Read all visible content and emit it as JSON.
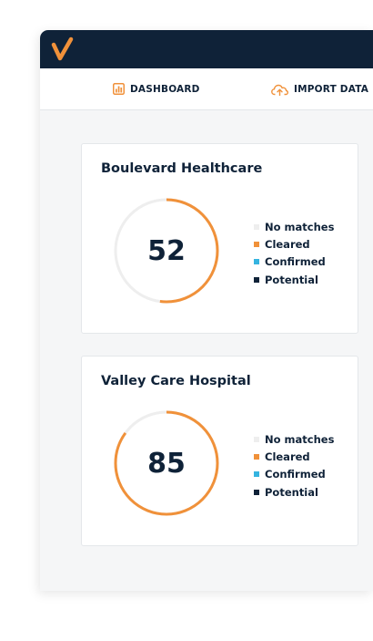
{
  "nav": {
    "dashboard_label": "DASHBOARD",
    "import_label": "IMPORT DATA"
  },
  "colors": {
    "navy": "#0f2238",
    "orange": "#f0913a",
    "cyan": "#35b4e0",
    "track": "#eeeeee"
  },
  "cards": [
    {
      "title": "Boulevard Healthcare",
      "value": "52",
      "cleared_fraction": 0.52,
      "legend": [
        "No matches",
        "Cleared",
        "Confirmed",
        "Potential"
      ]
    },
    {
      "title": "Valley Care Hospital",
      "value": "85",
      "cleared_fraction": 0.85,
      "legend": [
        "No matches",
        "Cleared",
        "Confirmed",
        "Potential"
      ]
    }
  ]
}
